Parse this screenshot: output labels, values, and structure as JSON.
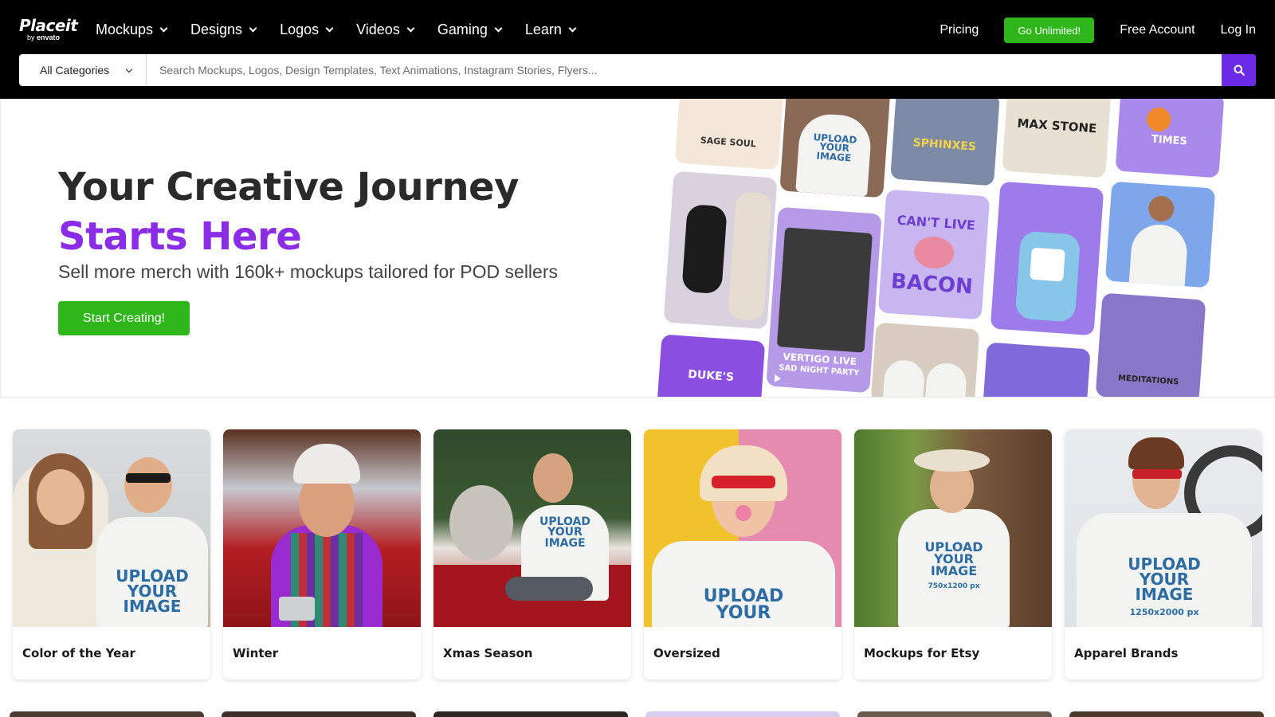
{
  "header": {
    "logo_brand": "Placeit",
    "logo_by": "by",
    "logo_company": "envato",
    "nav": [
      {
        "label": "Mockups"
      },
      {
        "label": "Designs"
      },
      {
        "label": "Logos"
      },
      {
        "label": "Videos"
      },
      {
        "label": "Gaming"
      },
      {
        "label": "Learn"
      }
    ],
    "pricing": "Pricing",
    "go_unlimited": "Go Unlimited!",
    "free_account": "Free Account",
    "login": "Log In"
  },
  "search": {
    "category": "All Categories",
    "placeholder": "Search Mockups, Logos, Design Templates, Text Animations, Instagram Stories, Flyers..."
  },
  "hero": {
    "title_line1": "Your Creative Journey",
    "title_line2": "Starts Here",
    "subtitle": "Sell more merch with 160k+ mockups tailored for POD sellers",
    "cta": "Start Creating!",
    "tiles": {
      "sage_soul": "SAGE SOUL",
      "sphinxes": "SPHINXES",
      "max_stone": "MAX STONE",
      "times": "TIMES",
      "cant_live": "CAN'T LIVE",
      "bacon": "BACON",
      "vertigo": "VERTIGO LIVE",
      "night_party": "SAD NIGHT PARTY",
      "dukes": "DUKE'S",
      "meditations": "MEDITATIONS",
      "upload_1": "UPLOAD",
      "upload_2": "YOUR",
      "upload_3": "IMAGE",
      "upload_size": "750x1200 px"
    }
  },
  "categories": [
    {
      "label": "Color of the Year"
    },
    {
      "label": "Winter"
    },
    {
      "label": "Xmas Season"
    },
    {
      "label": "Oversized"
    },
    {
      "label": "Mockups for Etsy"
    },
    {
      "label": "Apparel Brands"
    }
  ],
  "mockup_print": {
    "line1": "UPLOAD",
    "line2": "YOUR",
    "line3": "IMAGE",
    "size": "750x1200 px",
    "size_large": "1250x2000 px"
  },
  "colors": {
    "accent_purple": "#8b2ce6",
    "search_button": "#6b2ae6",
    "green": "#2fb61b",
    "header_bg": "#000000"
  }
}
